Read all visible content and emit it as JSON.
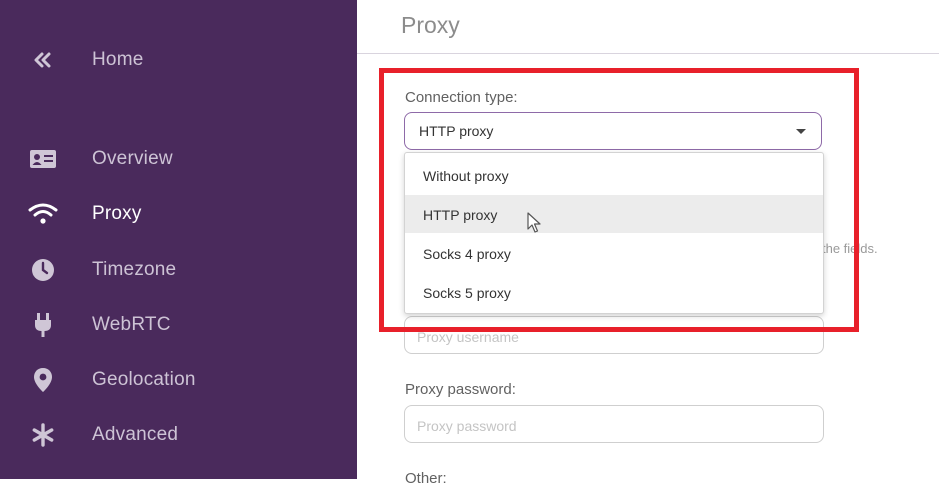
{
  "sidebar": {
    "home": {
      "label": "Home",
      "icon": "double-chevron-left-icon"
    },
    "items": [
      {
        "label": "Overview",
        "icon": "id-card-icon"
      },
      {
        "label": "Proxy",
        "icon": "wifi-icon"
      },
      {
        "label": "Timezone",
        "icon": "clock-icon"
      },
      {
        "label": "WebRTC",
        "icon": "plug-icon"
      },
      {
        "label": "Geolocation",
        "icon": "location-pin-icon"
      },
      {
        "label": "Advanced",
        "icon": "asterisk-icon"
      }
    ],
    "active": "Proxy",
    "background": "#4a2a5c"
  },
  "main": {
    "title": "Proxy",
    "connection_type": {
      "label": "Connection type:",
      "selected": "HTTP proxy",
      "options": [
        "Without proxy",
        "HTTP proxy",
        "Socks 4 proxy",
        "Socks 5 proxy"
      ],
      "hovered": "HTTP proxy"
    },
    "hint_fragment": "the fields.",
    "proxy_username": {
      "placeholder": "Proxy username"
    },
    "proxy_password": {
      "label": "Proxy password:",
      "placeholder": "Proxy password"
    },
    "other_label": "Other:"
  },
  "highlight_color": "#e8202a"
}
